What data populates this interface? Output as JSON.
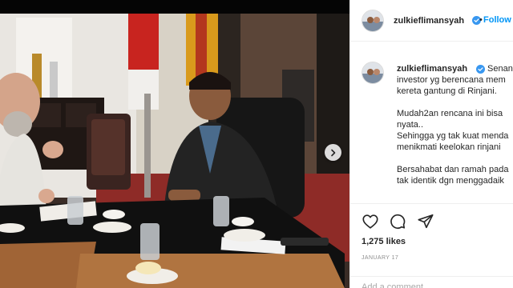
{
  "post": {
    "username": "zulkieflimansyah",
    "follow_label": "Follow",
    "dot": "•",
    "caption_lines": [
      "Senang",
      "investor yg berencana mem",
      "kereta gantung di Rinjani.",
      "",
      "Mudah2an rencana ini bisa",
      "nyata..",
      "Sehingga yg tak kuat menda",
      "menikmati keelokan rinjani",
      "",
      "Bersahabat dan ramah pada",
      "tak identik dgn menggadaik"
    ],
    "likes": "1,275 likes",
    "date": "JANUARY 17",
    "comment_placeholder": "Add a comment..."
  },
  "icons": {
    "verified": "verified-badge-icon",
    "like": "heart-icon",
    "comment": "comment-bubble-icon",
    "share": "paper-plane-icon",
    "next": "chevron-right-icon"
  },
  "colors": {
    "verified_blue": "#3897f0",
    "follow_blue": "#0095f6",
    "text": "#262626",
    "muted": "#8e8e8e",
    "divider": "#efefef"
  }
}
